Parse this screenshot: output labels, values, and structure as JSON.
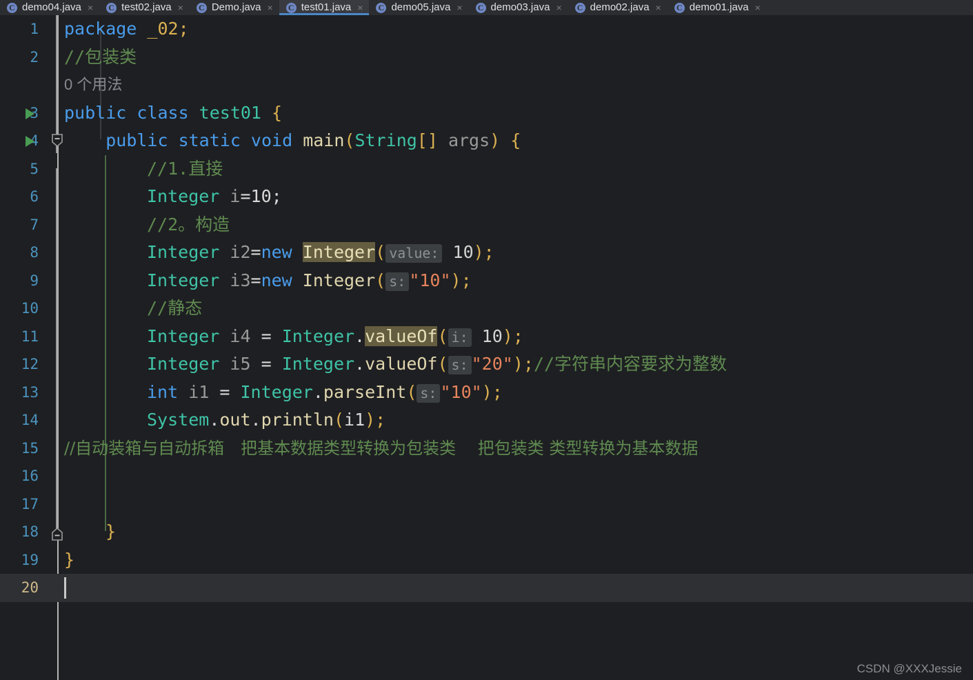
{
  "window": {
    "app": "IntelliJ IDEA Editor",
    "theme_bg": "#1e1f22",
    "accent": "#4a88c7"
  },
  "tabs": {
    "close_glyph": "×",
    "items": [
      {
        "label": "demo04.java",
        "icon": "java-class-icon",
        "active": false
      },
      {
        "label": "test02.java",
        "icon": "java-class-icon",
        "active": false
      },
      {
        "label": "Demo.java",
        "icon": "java-class-icon",
        "active": false
      },
      {
        "label": "test01.java",
        "icon": "java-class-icon",
        "active": true
      },
      {
        "label": "demo05.java",
        "icon": "java-class-icon",
        "active": false
      },
      {
        "label": "demo03.java",
        "icon": "java-class-icon",
        "active": false
      },
      {
        "label": "demo02.java",
        "icon": "java-class-icon",
        "active": false
      },
      {
        "label": "demo01.java",
        "icon": "java-class-icon",
        "active": false
      }
    ]
  },
  "editor": {
    "filename": "test01.java",
    "language": "java",
    "cursor_line": 20,
    "usage_hint": "0 个用法",
    "line_numbers": [
      "1",
      "2",
      "3",
      "4",
      "5",
      "6",
      "7",
      "8",
      "9",
      "10",
      "11",
      "12",
      "13",
      "14",
      "15",
      "16",
      "17",
      "18",
      "19",
      "20"
    ],
    "lines": {
      "l1_kw": "package",
      "l1_name": " _02;",
      "l2_comment": "//包装类",
      "l3_kw1": "public",
      "l3_kw2": " class ",
      "l3_name": "test01",
      "l3_brace": " {",
      "l4_kw": "public static void ",
      "l4_method": "main",
      "l4_p1": "(",
      "l4_type": "String",
      "l4_p2": "[] ",
      "l4_arg": "args",
      "l4_p3": ") {",
      "l5_comment": "//1.直接",
      "l6_type": "Integer",
      "l6_var": " i",
      "l6_rest": "=10;",
      "l7_comment": "//2。构造",
      "l8_type": "Integer",
      "l8_var": " i2",
      "l8_eq": "=",
      "l8_new": "new ",
      "l8_ctor": "Integer",
      "l8_paren": "(",
      "l8_hint": "value:",
      "l8_val": " 10",
      "l8_end": ");",
      "l9_type": "Integer",
      "l9_var": " i3",
      "l9_eq": "=",
      "l9_new": "new ",
      "l9_ctor": "Integer",
      "l9_paren": "(",
      "l9_hint": "s:",
      "l9_val": "\"10\"",
      "l9_end": ");",
      "l10_comment": "//静态",
      "l11_type": "Integer",
      "l11_var": " i4 ",
      "l11_eq": "= ",
      "l11_cls": "Integer",
      "l11_dot": ".",
      "l11_method": "valueOf",
      "l11_paren": "(",
      "l11_hint": "i:",
      "l11_val": " 10",
      "l11_end": ");",
      "l12_type": "Integer",
      "l12_var": " i5 ",
      "l12_eq": "= ",
      "l12_cls": "Integer",
      "l12_dot": ".",
      "l12_method": "valueOf",
      "l12_paren": "(",
      "l12_hint": "s:",
      "l12_val": "\"20\"",
      "l12_end": ");",
      "l12_comment": "//字符串内容要求为整数",
      "l13_kw": "int",
      "l13_var": " i1 ",
      "l13_eq": "= ",
      "l13_cls": "Integer",
      "l13_dot": ".",
      "l13_method": "parseInt",
      "l13_paren": "(",
      "l13_hint": "s:",
      "l13_val": "\"10\"",
      "l13_end": ");",
      "l14_cls": "System",
      "l14_dot1": ".",
      "l14_out": "out",
      "l14_dot2": ".",
      "l14_method": "println",
      "l14_paren": "(",
      "l14_arg": "i1",
      "l14_end": ");",
      "l15_comment": "//自动装箱与自动拆箱　把基本数据类型转换为包装类　 把包装类 类型转换为基本数据",
      "l18_brace": "}",
      "l19_brace": "}"
    }
  },
  "watermark": {
    "text": "CSDN @XXXJessie"
  }
}
